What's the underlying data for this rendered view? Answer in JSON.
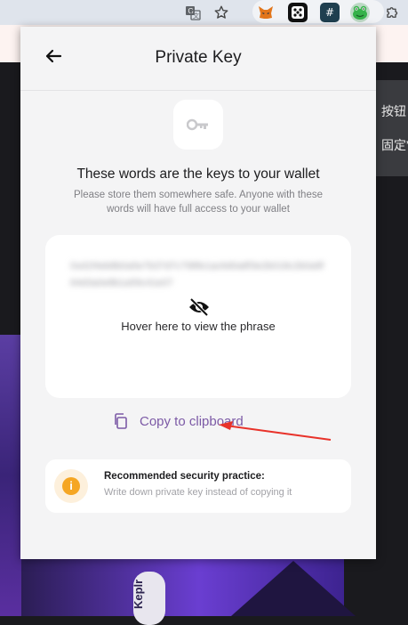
{
  "browser": {
    "toolbar_icons": [
      "translate-icon",
      "star-icon"
    ],
    "extensions": [
      "metamask-icon",
      "dice-icon",
      "hash-icon",
      "frog-icon",
      "puzzle-icon"
    ]
  },
  "background": {
    "right_panel_lines": [
      "按钮",
      "固定”"
    ],
    "kepler_label": "Keplr"
  },
  "popup": {
    "title": "Private Key",
    "heading": "These words are the keys to your wallet",
    "subtext": "Please store them somewhere safe. Anyone with these words will have full access to your wallet",
    "blurred_phrase": "0xd1f4eb8b0a5e7b37d7c798fe1ac6d0a8f3e2b018c2b0a9f64d3a0e8b1a59c41e07",
    "hover_label": "Hover here to view the phrase",
    "copy_label": "Copy to clipboard",
    "tip_title": "Recommended security practice:",
    "tip_desc": "Write down private key instead of copying it",
    "colors": {
      "accent": "#7c5aa6",
      "warning": "#f5a623",
      "annotation_arrow": "#e8322a"
    }
  }
}
